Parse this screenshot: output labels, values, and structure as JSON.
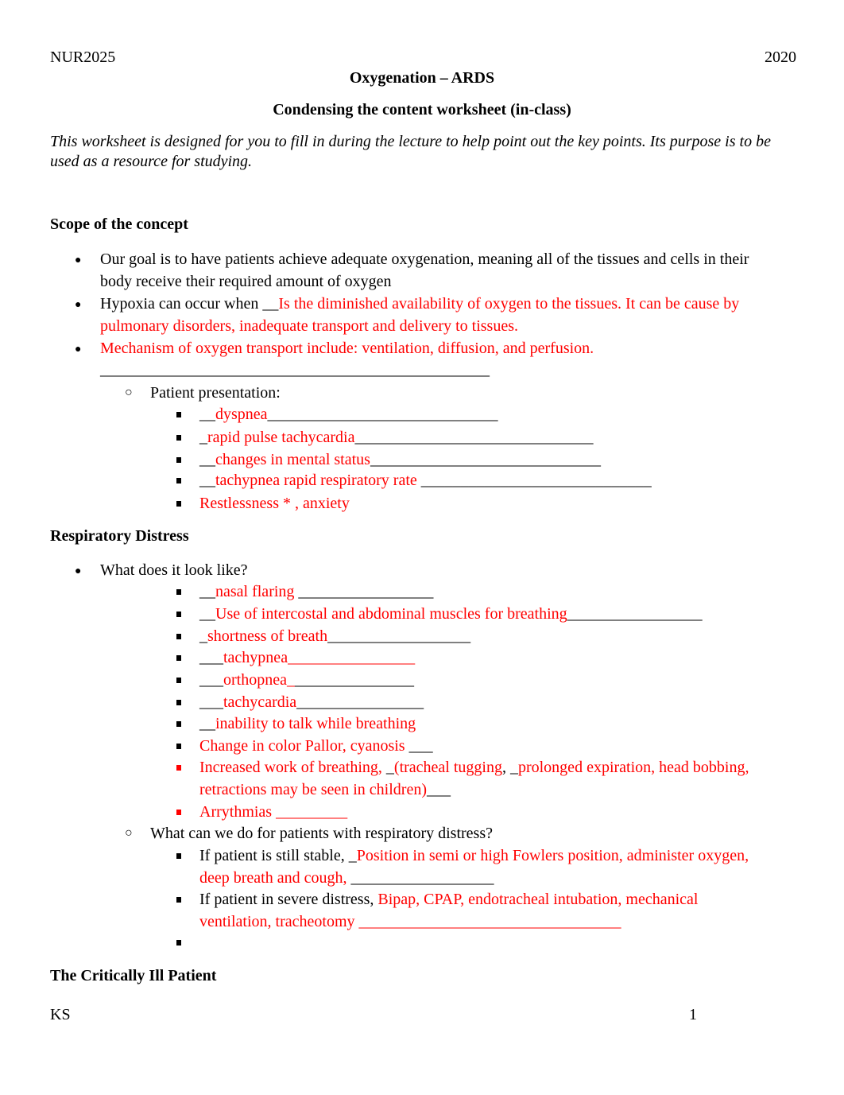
{
  "header": {
    "left": "NUR2025",
    "right": "2020"
  },
  "title": "Oxygenation – ARDS",
  "subtitle": "Condensing the content worksheet (in-class)",
  "intro": "This worksheet is designed for you to fill in during the lecture to help point out the key points. Its purpose is to be used as a resource for studying.",
  "colors": {
    "answer": "#ff0000",
    "text": "#000000"
  },
  "sections": {
    "scope": {
      "heading": "Scope of the concept",
      "lines": [
        {
          "bullet": "disc",
          "segs": [
            {
              "t": "Our goal is to have patients achieve adequate oxygenation, meaning all of the tissues and cells in their",
              "c": "blk"
            }
          ]
        },
        {
          "bullet": "none",
          "segs": [
            {
              "t": "body receive their required amount of oxygen",
              "c": "blk"
            }
          ]
        },
        {
          "bullet": "disc",
          "segs": [
            {
              "t": "Hypoxia can occur when __",
              "c": "blk"
            },
            {
              "t": "Is the diminished availability of oxygen to the tissues. It can be cause by",
              "c": "red"
            }
          ]
        },
        {
          "bullet": "none",
          "segs": [
            {
              "t": "pulmonary disorders, inadequate transport and delivery to tissues.",
              "c": "red"
            }
          ]
        },
        {
          "bullet": "disc",
          "segs": [
            {
              "t": "Mechanism of oxygen transport include: ventilation, diffusion, and perfusion.",
              "c": "red"
            }
          ]
        },
        {
          "bullet": "none",
          "segs": [
            {
              "t": "_________________________________________________",
              "c": "blk"
            }
          ]
        },
        {
          "bullet": "circle",
          "segs": [
            {
              "t": "Patient presentation:",
              "c": "blk"
            }
          ]
        },
        {
          "bullet": "square",
          "segs": [
            {
              "t": "__",
              "c": "blk"
            },
            {
              "t": "dyspnea",
              "c": "red"
            },
            {
              "t": "_____________________________",
              "c": "blk"
            }
          ]
        },
        {
          "bullet": "square",
          "segs": [
            {
              "t": "_",
              "c": "blk"
            },
            {
              "t": "rapid pulse tachycardia",
              "c": "red"
            },
            {
              "t": "______________________________",
              "c": "blk"
            }
          ]
        },
        {
          "bullet": "square",
          "segs": [
            {
              "t": "__",
              "c": "blk"
            },
            {
              "t": "changes in mental status",
              "c": "red"
            },
            {
              "t": "_____________________________",
              "c": "blk"
            }
          ]
        },
        {
          "bullet": "square",
          "segs": [
            {
              "t": "__",
              "c": "blk"
            },
            {
              "t": "tachypnea rapid respiratory rate ",
              "c": "red"
            },
            {
              "t": "_____________________________",
              "c": "blk"
            }
          ]
        },
        {
          "bullet": "square",
          "segs": [
            {
              "t": "Restlessness * , anxiety",
              "c": "red"
            }
          ]
        }
      ]
    },
    "distress": {
      "heading": "Respiratory Distress",
      "lines": [
        {
          "bullet": "disc",
          "segs": [
            {
              "t": "What does it look like?",
              "c": "blk"
            }
          ]
        },
        {
          "bullet": "square",
          "segs": [
            {
              "t": "__",
              "c": "blk"
            },
            {
              "t": "nasal flaring ",
              "c": "red"
            },
            {
              "t": "_________________",
              "c": "blk"
            }
          ]
        },
        {
          "bullet": "square",
          "segs": [
            {
              "t": "__",
              "c": "blk"
            },
            {
              "t": "Use of intercostal and abdominal muscles for breathing",
              "c": "red"
            },
            {
              "t": "_________________",
              "c": "blk"
            }
          ]
        },
        {
          "bullet": "square",
          "segs": [
            {
              "t": "_",
              "c": "blk"
            },
            {
              "t": "shortness of breath",
              "c": "red"
            },
            {
              "t": "__________________",
              "c": "blk"
            }
          ]
        },
        {
          "bullet": "square",
          "segs": [
            {
              "t": "___",
              "c": "blk"
            },
            {
              "t": "tachypnea________________",
              "c": "red"
            }
          ]
        },
        {
          "bullet": "square",
          "segs": [
            {
              "t": "___",
              "c": "blk"
            },
            {
              "t": "orthopnea_",
              "c": "red"
            },
            {
              "t": "_______________",
              "c": "blk"
            }
          ]
        },
        {
          "bullet": "square",
          "segs": [
            {
              "t": "___",
              "c": "blk"
            },
            {
              "t": "tachycardia",
              "c": "red"
            },
            {
              "t": "________________",
              "c": "blk"
            }
          ]
        },
        {
          "bullet": "square",
          "segs": [
            {
              "t": "__",
              "c": "blk"
            },
            {
              "t": "inability to talk while breathing",
              "c": "red"
            }
          ]
        },
        {
          "bullet": "square",
          "segs": [
            {
              "t": "Change in color Pallor, cyanosis ",
              "c": "red"
            },
            {
              "t": "___",
              "c": "blk"
            }
          ]
        },
        {
          "bullet": "square-red",
          "segs": [
            {
              "t": "Increased work of breathing, ",
              "c": "red"
            },
            {
              "t": "_",
              "c": "blk"
            },
            {
              "t": "(tracheal tugging",
              "c": "red"
            },
            {
              "t": ", _",
              "c": "blk"
            },
            {
              "t": "prolonged expiration, head bobbing,",
              "c": "red"
            }
          ]
        },
        {
          "bullet": "none",
          "segs": [
            {
              "t": "retractions may be seen in children)",
              "c": "red"
            },
            {
              "t": "___",
              "c": "blk"
            }
          ]
        },
        {
          "bullet": "square-red",
          "segs": [
            {
              "t": "Arrythmias _________",
              "c": "red"
            }
          ]
        },
        {
          "bullet": "circle",
          "segs": [
            {
              "t": "What can we do for patients with respiratory distress?",
              "c": "blk"
            }
          ]
        },
        {
          "bullet": "square",
          "segs": [
            {
              "t": "If patient is still stable, _",
              "c": "blk"
            },
            {
              "t": "Position in semi or high Fowlers position, administer oxygen,",
              "c": "red"
            }
          ]
        },
        {
          "bullet": "none",
          "segs": [
            {
              "t": "deep breath and cough, ",
              "c": "red"
            },
            {
              "t": "__________________",
              "c": "blk"
            }
          ]
        },
        {
          "bullet": "square",
          "segs": [
            {
              "t": "If patient in severe distress, ",
              "c": "blk"
            },
            {
              "t": "Bipap, CPAP, endotracheal intubation, mechanical",
              "c": "red"
            }
          ]
        },
        {
          "bullet": "none",
          "segs": [
            {
              "t": "ventilation, tracheotomy _________________________________",
              "c": "red"
            }
          ]
        },
        {
          "bullet": "square",
          "segs": []
        }
      ]
    },
    "critical": {
      "heading": "The Critically Ill Patient"
    }
  },
  "footer": {
    "left": "KS",
    "page_number": "1"
  }
}
